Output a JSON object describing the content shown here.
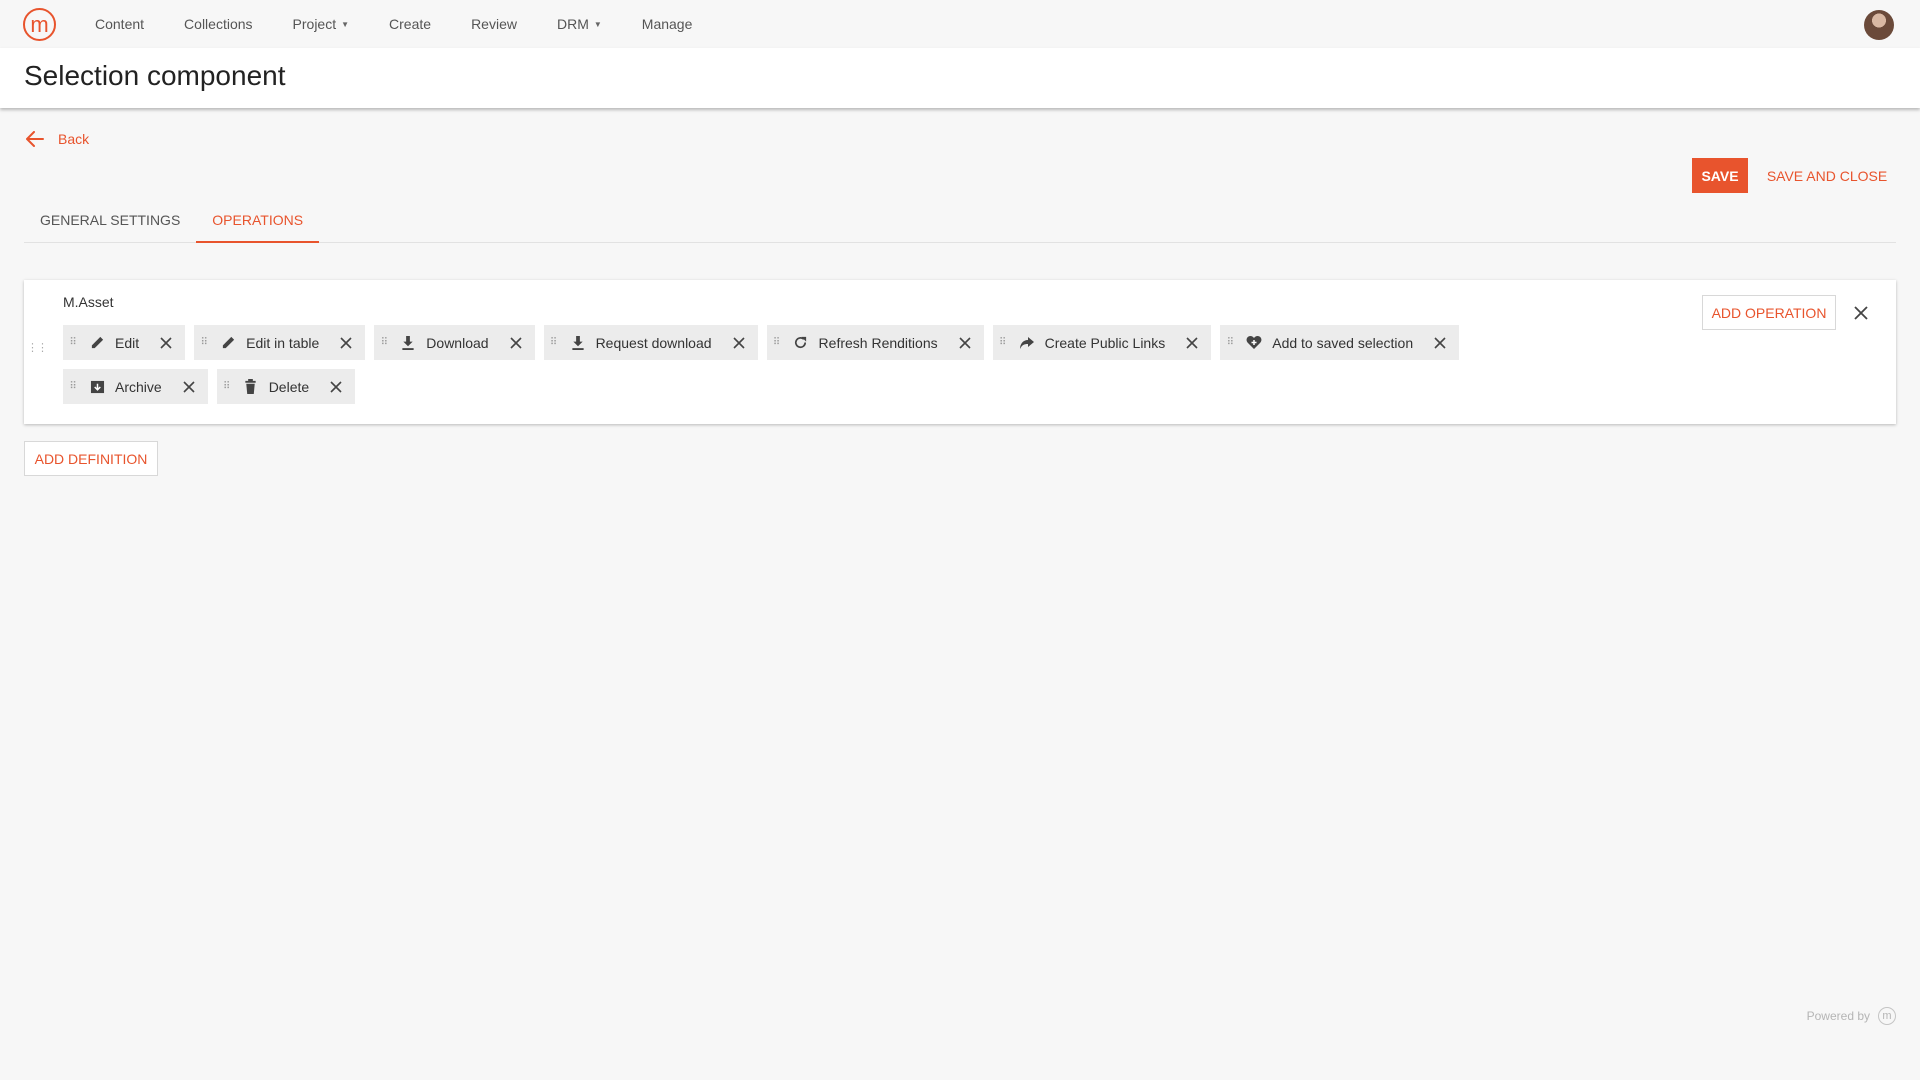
{
  "brand": {
    "logo_glyph": "m",
    "accent_color": "#e8542d"
  },
  "nav": {
    "items": [
      {
        "label": "Content",
        "has_caret": false
      },
      {
        "label": "Collections",
        "has_caret": false
      },
      {
        "label": "Project",
        "has_caret": true
      },
      {
        "label": "Create",
        "has_caret": false
      },
      {
        "label": "Review",
        "has_caret": false
      },
      {
        "label": "DRM",
        "has_caret": true
      },
      {
        "label": "Manage",
        "has_caret": false
      }
    ],
    "avatar_icon": "user-avatar"
  },
  "page": {
    "title": "Selection component"
  },
  "back": {
    "label": "Back",
    "icon": "arrow-left-icon"
  },
  "actions": {
    "save": "SAVE",
    "save_and_close": "SAVE AND CLOSE"
  },
  "tabs": [
    {
      "label": "GENERAL SETTINGS",
      "active": false
    },
    {
      "label": "OPERATIONS",
      "active": true
    }
  ],
  "definition": {
    "title": "M.Asset",
    "add_operation": "ADD OPERATION",
    "operations_row1": [
      {
        "label": "Edit",
        "icon": "pencil-icon"
      },
      {
        "label": "Edit in table",
        "icon": "pencil-icon"
      },
      {
        "label": "Download",
        "icon": "download-icon"
      },
      {
        "label": "Request download",
        "icon": "download-icon"
      },
      {
        "label": "Refresh Renditions",
        "icon": "refresh-icon"
      },
      {
        "label": "Create Public Links",
        "icon": "share-icon"
      },
      {
        "label": "Add to saved selection",
        "icon": "heart-add-icon"
      }
    ],
    "operations_row2": [
      {
        "label": "Archive",
        "icon": "archive-icon"
      },
      {
        "label": "Delete",
        "icon": "trash-icon"
      }
    ]
  },
  "add_definition": "ADD DEFINITION",
  "footer": {
    "powered_by": "Powered by",
    "logo_glyph": "m"
  }
}
